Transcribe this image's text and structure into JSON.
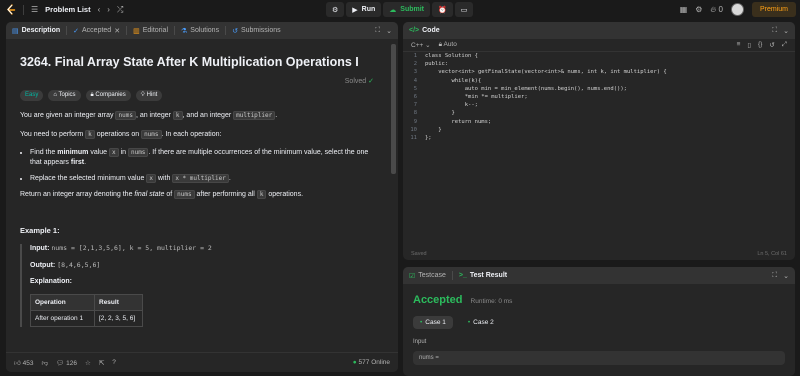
{
  "topbar": {
    "problem_list": "Problem List",
    "run": "Run",
    "submit": "Submit",
    "streak": "0",
    "premium": "Premium"
  },
  "desc_panel": {
    "tabs": [
      {
        "label": "Description",
        "icon": "document-icon"
      },
      {
        "label": "Accepted",
        "icon": "check-icon"
      },
      {
        "label": "Editorial",
        "icon": "book-icon"
      },
      {
        "label": "Solutions",
        "icon": "flask-icon"
      },
      {
        "label": "Submissions",
        "icon": "history-icon"
      }
    ],
    "title": "3264. Final Array State After K Multiplication Operations I",
    "solved": "Solved",
    "tags": {
      "difficulty": "Easy",
      "topics": "Topics",
      "companies": "Companies",
      "hint": "Hint"
    },
    "p1": {
      "a": "You are given an integer array ",
      "nums": "nums",
      "b": ", an integer ",
      "k": "k",
      "c": ", and an integer ",
      "mult": "multiplier",
      "d": "."
    },
    "p2": {
      "a": "You need to perform ",
      "k": "k",
      "b": " operations on ",
      "nums": "nums",
      "c": ". In each operation:"
    },
    "bullet1": {
      "a": "Find the ",
      "bold1": "minimum",
      "b": " value ",
      "x": "x",
      "c": " in ",
      "nums": "nums",
      "d": ". If there are multiple occurrences of the minimum value, select the one that appears ",
      "bold2": "first",
      "e": "."
    },
    "bullet2": {
      "a": "Replace the selected minimum value ",
      "x": "x",
      "b": " with ",
      "expr": "x * multiplier",
      "c": "."
    },
    "p3": {
      "a": "Return an integer array denoting the ",
      "final": "final state",
      "b": " of ",
      "nums": "nums",
      "c": " after performing all ",
      "k": "k",
      "d": " operations."
    },
    "example_title": "Example 1:",
    "input_label": "Input:",
    "input_value": "nums = [2,1,3,5,6], k = 5, multiplier = 2",
    "output_label": "Output:",
    "output_value": "[8,4,6,5,6]",
    "explanation_label": "Explanation:",
    "table": {
      "headers": [
        "Operation",
        "Result"
      ],
      "rows": [
        [
          "After operation 1",
          "[2, 2, 3, 5, 6]"
        ]
      ]
    },
    "footer": {
      "likes": "453",
      "comments": "126",
      "online": "577 Online"
    }
  },
  "code_panel": {
    "title": "Code",
    "language": "C++",
    "autosave": "Auto",
    "saved": "Saved",
    "cursor": "Ln 5, Col 61",
    "lines": [
      "class Solution {",
      "public:",
      "    vector<int> getFinalState(vector<int>& nums, int k, int multiplier) {",
      "        while(k){",
      "            auto min = min_element(nums.begin(), nums.end());",
      "            *min *= multiplier;",
      "            k--;",
      "        }",
      "        return nums;",
      "    }",
      "};"
    ]
  },
  "result_panel": {
    "tabs": [
      {
        "label": "Testcase",
        "icon": "checkbox-icon"
      },
      {
        "label": "Test Result",
        "icon": "terminal-icon"
      }
    ],
    "status": "Accepted",
    "runtime": "Runtime: 0 ms",
    "cases": [
      "Case 1",
      "Case 2"
    ],
    "input_label": "Input",
    "input_value": "nums ="
  }
}
